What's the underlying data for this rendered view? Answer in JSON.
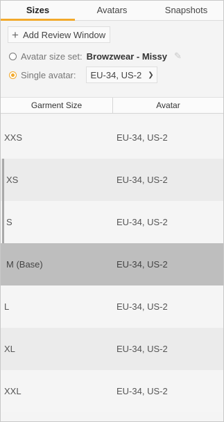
{
  "tabs": [
    {
      "label": "Sizes",
      "active": true
    },
    {
      "label": "Avatars",
      "active": false
    },
    {
      "label": "Snapshots",
      "active": false
    }
  ],
  "toolbar": {
    "add_review_label": "Add Review Window",
    "add_icon": "plus-icon"
  },
  "avatar_options": {
    "size_set_label": "Avatar size set:",
    "size_set_value": "Browzwear - Missy",
    "size_set_selected": false,
    "single_label": "Single avatar:",
    "single_value": "EU-34, US-2",
    "single_selected": true
  },
  "table": {
    "headers": [
      "Garment Size",
      "Avatar"
    ],
    "rows": [
      {
        "size": "XXS",
        "avatar": "EU-34, US-2"
      },
      {
        "size": "XS",
        "avatar": "EU-34, US-2"
      },
      {
        "size": "S",
        "avatar": "EU-34, US-2"
      },
      {
        "size": "M (Base)",
        "avatar": "EU-34, US-2",
        "selected": true
      },
      {
        "size": "L",
        "avatar": "EU-34, US-2"
      },
      {
        "size": "XL",
        "avatar": "EU-34, US-2"
      },
      {
        "size": "XXL",
        "avatar": "EU-34, US-2"
      }
    ]
  },
  "colors": {
    "accent": "#f2a92b",
    "selected_row": "#bebebe"
  }
}
